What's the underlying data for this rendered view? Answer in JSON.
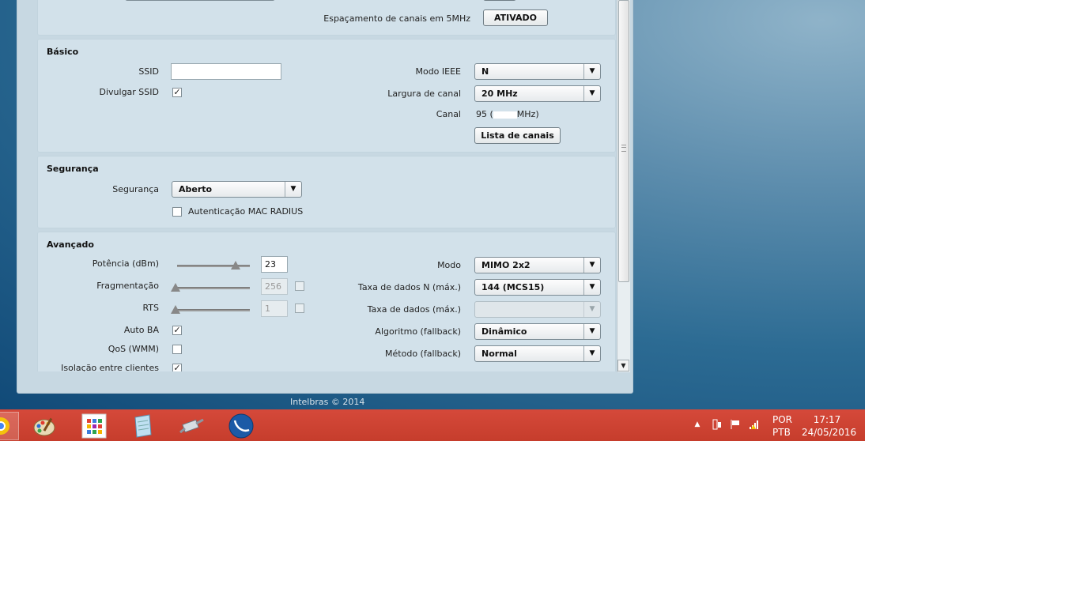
{
  "top_row": {
    "spacing_label": "Espaçamento de canais em 5MHz",
    "spacing_button": "ATIVADO"
  },
  "basic": {
    "heading": "Básico",
    "ssid_label": "SSID",
    "ssid_value": "",
    "broadcast_label": "Divulgar SSID",
    "ieee_label": "Modo IEEE",
    "ieee_value": "N",
    "width_label": "Largura de canal",
    "width_value": "20 MHz",
    "channel_label": "Canal",
    "channel_value_prefix": "95 (",
    "channel_value_suffix": "MHz)",
    "channel_list_button": "Lista de canais"
  },
  "security": {
    "heading": "Segurança",
    "label": "Segurança",
    "value": "Aberto",
    "mac_radius_label": "Autenticação MAC RADIUS"
  },
  "advanced": {
    "heading": "Avançado",
    "power_label": "Potência (dBm)",
    "power_value": "23",
    "power_level": 0.8,
    "frag_label": "Fragmentação",
    "frag_value": "256",
    "rts_label": "RTS",
    "rts_value": "1",
    "autoba_label": "Auto BA",
    "qos_label": "QoS (WMM)",
    "isolation_label": "Isolação entre clientes",
    "mode_label": "Modo",
    "mode_value": "MIMO 2x2",
    "ndata_label": "Taxa de dados N (máx.)",
    "ndata_value": "144 (MCS15)",
    "data_label": "Taxa de dados (máx.)",
    "data_value": "",
    "algo_label": "Algoritmo (fallback)",
    "algo_value": "Dinâmico",
    "method_label": "Método (fallback)",
    "method_value": "Normal"
  },
  "footer": "Intelbras © 2014",
  "taskbar": {
    "language_line1": "POR",
    "language_line2": "PTB",
    "time": "17:17",
    "date": "24/05/2016",
    "icons": [
      "chrome-icon",
      "paint-icon",
      "apps-icon",
      "notepad-icon",
      "network-cable-icon",
      "winbox-icon"
    ]
  },
  "colors": {
    "taskbar": "#c63d2c",
    "panel": "#d2e1ea",
    "desktop": "#2c6b93"
  }
}
